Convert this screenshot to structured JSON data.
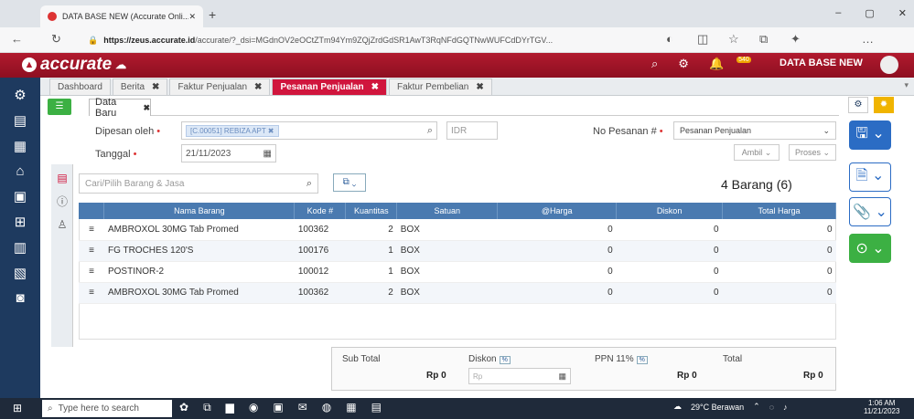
{
  "browser": {
    "tab_title": "DATA BASE NEW (Accurate Onli...",
    "url_domain": "https://zeus.accurate.id",
    "url_rest": "/accurate/?_dsi=MGdnOV2eOCtZTm94Ym9ZQjZrdGdSR1AwT3RqNFdGQTNwWUFCdDYrTGV...",
    "new_tab": "+",
    "win_min": "–",
    "win_max": "▢",
    "win_close": "✕"
  },
  "app": {
    "logo": "accurate",
    "db_name": "DATA BASE NEW",
    "notif_count": "540"
  },
  "tabs": [
    {
      "label": "Dashboard"
    },
    {
      "label": "Berita"
    },
    {
      "label": "Faktur Penjualan"
    },
    {
      "label": "Pesanan Penjualan"
    },
    {
      "label": "Faktur Pembelian"
    }
  ],
  "subtab": {
    "label": "Data Baru"
  },
  "form": {
    "ordered_by_label": "Dipesan oleh",
    "ordered_by_value": "[C.00051] REBIZA APT",
    "currency": "IDR",
    "order_no_label": "No Pesanan #",
    "order_no_value": "Pesanan Penjualan",
    "date_label": "Tanggal",
    "date_value": "21/11/2023",
    "ambil_label": "Ambil",
    "proses_label": "Proses"
  },
  "items": {
    "search_placeholder": "Cari/Pilih Barang & Jasa",
    "count_text": "4 Barang (6)",
    "headers": [
      "",
      "Nama Barang",
      "Kode #",
      "Kuantitas",
      "Satuan",
      "@Harga",
      "Diskon",
      "Total Harga"
    ],
    "rows": [
      {
        "name": "AMBROXOL 30MG Tab Promed",
        "code": "100362",
        "qty": "2",
        "unit": "BOX",
        "price": "0",
        "disc": "0",
        "total": "0"
      },
      {
        "name": "FG TROCHES 120'S",
        "code": "100176",
        "qty": "1",
        "unit": "BOX",
        "price": "0",
        "disc": "0",
        "total": "0"
      },
      {
        "name": "POSTINOR-2",
        "code": "100012",
        "qty": "1",
        "unit": "BOX",
        "price": "0",
        "disc": "0",
        "total": "0"
      },
      {
        "name": "AMBROXOL 30MG Tab Promed",
        "code": "100362",
        "qty": "2",
        "unit": "BOX",
        "price": "0",
        "disc": "0",
        "total": "0"
      }
    ]
  },
  "totals": {
    "subtotal_label": "Sub Total",
    "subtotal_value": "Rp 0",
    "discount_label": "Diskon",
    "discount_placeholder": "Rp",
    "ppn_label": "PPN 11%",
    "ppn_value": "Rp 0",
    "total_label": "Total",
    "total_value": "Rp 0",
    "pct": "%"
  },
  "taskbar": {
    "search_placeholder": "Type here to search",
    "weather": "29°C Berawan",
    "time": "1:06 AM",
    "date": "11/21/2023"
  },
  "colors": {
    "brand": "#b11a2e",
    "active_tab": "#d0153d",
    "table_header": "#4a7ab0",
    "sidebar": "#1e3a5f"
  }
}
